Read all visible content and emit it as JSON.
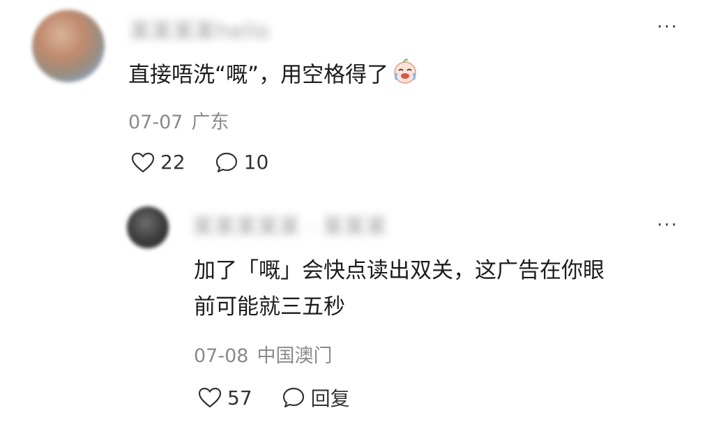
{
  "comment": {
    "author": "某某某某hello",
    "text": "直接唔洗“嘅”，用空格得了",
    "emoji": "crying-laughing-emoji",
    "date": "07-07",
    "location": "广东",
    "likes": "22",
    "replies": "10",
    "more": "···"
  },
  "reply": {
    "author": "某某某某某 · 某某某",
    "text_line1": "加了「嘅」会快点读出双关，这广告在你眼",
    "text_line2": "前可能就三五秒",
    "date": "07-08",
    "location": "中国澳门",
    "likes": "57",
    "reply_label": "回复",
    "more": "···"
  }
}
